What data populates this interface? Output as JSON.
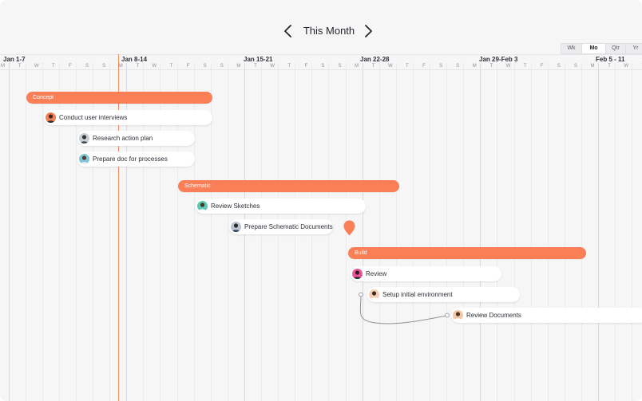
{
  "header": {
    "period_title": "This Month",
    "prev_icon": "chevron-left-icon",
    "next_icon": "chevron-right-icon",
    "scales": [
      {
        "label": "Wk",
        "active": false
      },
      {
        "label": "Mo",
        "active": true
      },
      {
        "label": "Qtr",
        "active": false
      },
      {
        "label": "Yr",
        "active": false
      }
    ]
  },
  "timeline": {
    "weeks": [
      "Jan 1-7",
      "Jan 8-14",
      "Jan 15-21",
      "Jan 22-28",
      "Jan 29-Feb 3",
      "Feb 5 - 11"
    ],
    "day_letters": [
      "M",
      "T",
      "W",
      "T",
      "F",
      "S",
      "S"
    ],
    "today_marker": "Jan 8"
  },
  "phases": [
    {
      "name": "Concept",
      "tasks": [
        {
          "label": "Conduct user interviews",
          "avatar": "person-avatar"
        },
        {
          "label": "Research action plan",
          "avatar": "person-avatar"
        },
        {
          "label": "Prepare doc for processes",
          "avatar": "person-avatar"
        }
      ]
    },
    {
      "name": "Schematic",
      "tasks": [
        {
          "label": "Review Sketches",
          "avatar": "person-avatar"
        },
        {
          "label": "Prepare Schematic Documents",
          "avatar": "person-avatar"
        }
      ]
    },
    {
      "name": "Build",
      "tasks": [
        {
          "label": "Review",
          "avatar": "person-avatar"
        },
        {
          "label": "Setup initial environment",
          "avatar": "person-avatar"
        },
        {
          "label": "Review Documents",
          "avatar": "person-avatar"
        }
      ]
    }
  ],
  "milestone_icon": "milestone-marker-icon",
  "colors": {
    "accent": "#fa7e56",
    "today_line": "#f38b63",
    "background": "#f6f6f7"
  }
}
